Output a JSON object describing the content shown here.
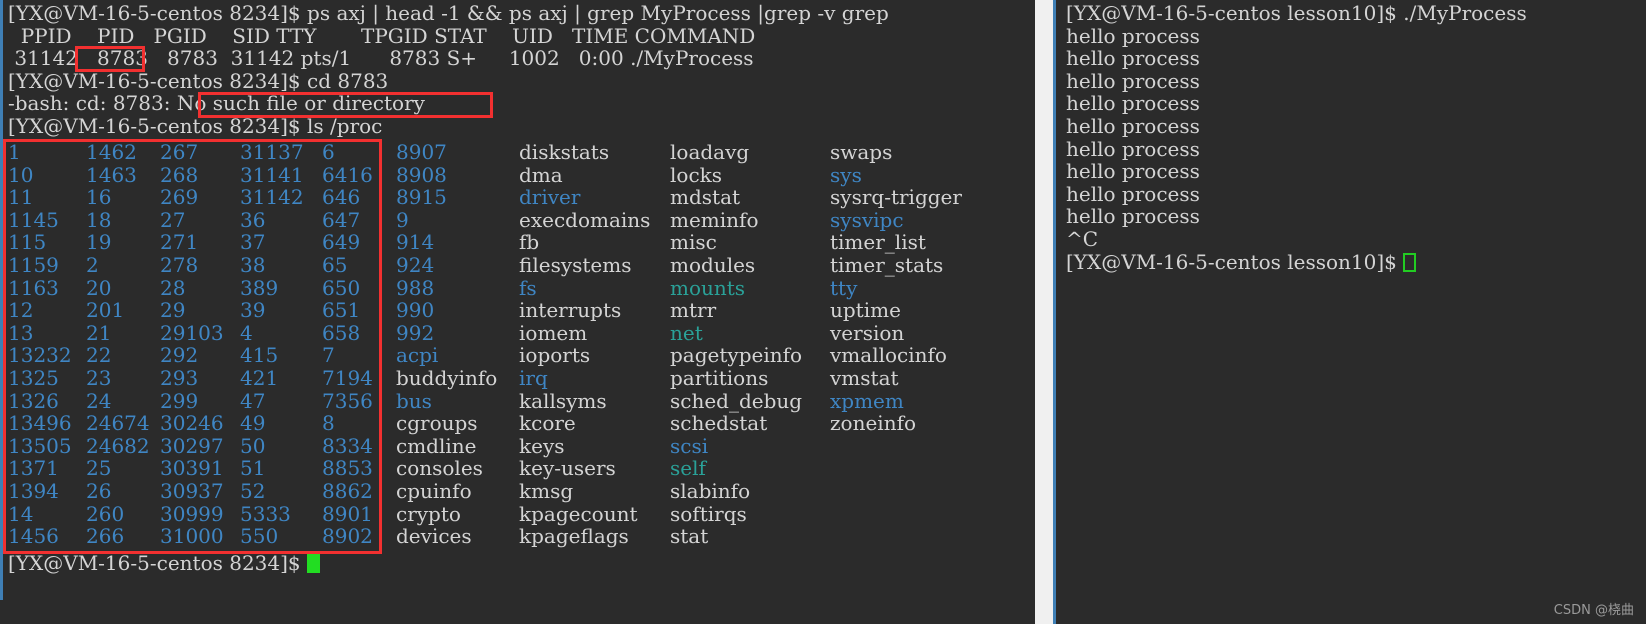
{
  "left_terminal": {
    "lines": [
      "[YX@VM-16-5-centos 8234]$ ps axj | head -1 && ps axj | grep MyProcess |grep -v grep",
      "  PPID    PID   PGID    SID TTY       TPGID STAT    UID   TIME COMMAND",
      " 31142   8783   8783  31142 pts/1      8783 S+     1002   0:00 ./MyProcess",
      "[YX@VM-16-5-centos 8234]$ cd 8783",
      "-bash: cd: 8783: No such file or directory",
      "[YX@VM-16-5-centos 8234]$ ls /proc"
    ],
    "prompt_final": "[YX@VM-16-5-centos 8234]$ ",
    "proc_listing": {
      "numeric_columns": [
        [
          "1",
          "10",
          "11",
          "1145",
          "115",
          "1159",
          "1163",
          "12",
          "13",
          "13232",
          "1325",
          "1326",
          "13496",
          "13505",
          "1371",
          "1394",
          "14",
          "1456"
        ],
        [
          "1462",
          "1463",
          "16",
          "18",
          "19",
          "2",
          "20",
          "201",
          "21",
          "22",
          "23",
          "24",
          "24674",
          "24682",
          "25",
          "26",
          "260",
          "266"
        ],
        [
          "267",
          "268",
          "269",
          "27",
          "271",
          "278",
          "28",
          "29",
          "29103",
          "292",
          "293",
          "299",
          "30246",
          "30297",
          "30391",
          "30937",
          "30999",
          "31000"
        ],
        [
          "31137",
          "31141",
          "31142",
          "36",
          "37",
          "38",
          "389",
          "39",
          "4",
          "415",
          "421",
          "47",
          "49",
          "50",
          "51",
          "52",
          "5333",
          "550"
        ],
        [
          "6",
          "6416",
          "646",
          "647",
          "649",
          "65",
          "650",
          "651",
          "658",
          "7",
          "7194",
          "7356",
          "8",
          "8334",
          "8853",
          "8862",
          "8901",
          "8902"
        ],
        [
          "8907",
          "8908",
          "8915",
          "9",
          "914",
          "924",
          "988",
          "990",
          "992",
          "acpi",
          "buddyinfo",
          "bus",
          "cgroups",
          "cmdline",
          "consoles",
          "cpuinfo",
          "crypto",
          "devices"
        ]
      ],
      "numeric_column_types": [
        [
          "dir",
          "dir",
          "dir",
          "dir",
          "dir",
          "dir",
          "dir",
          "dir",
          "dir",
          "dir",
          "dir",
          "dir",
          "dir",
          "dir",
          "dir",
          "dir",
          "dir",
          "dir"
        ],
        [
          "dir",
          "dir",
          "dir",
          "dir",
          "dir",
          "dir",
          "dir",
          "dir",
          "dir",
          "dir",
          "dir",
          "dir",
          "dir",
          "dir",
          "dir",
          "dir",
          "dir",
          "dir"
        ],
        [
          "dir",
          "dir",
          "dir",
          "dir",
          "dir",
          "dir",
          "dir",
          "dir",
          "dir",
          "dir",
          "dir",
          "dir",
          "dir",
          "dir",
          "dir",
          "dir",
          "dir",
          "dir"
        ],
        [
          "dir",
          "dir",
          "dir",
          "dir",
          "dir",
          "dir",
          "dir",
          "dir",
          "dir",
          "dir",
          "dir",
          "dir",
          "dir",
          "dir",
          "dir",
          "dir",
          "dir",
          "dir"
        ],
        [
          "dir",
          "dir",
          "dir",
          "dir",
          "dir",
          "dir",
          "dir",
          "dir",
          "dir",
          "dir",
          "dir",
          "dir",
          "dir",
          "dir",
          "dir",
          "dir",
          "dir",
          "dir"
        ],
        [
          "dir",
          "dir",
          "dir",
          "dir",
          "dir",
          "dir",
          "dir",
          "dir",
          "dir",
          "dir",
          "file",
          "dir",
          "file",
          "file",
          "file",
          "file",
          "file",
          "file"
        ]
      ],
      "name_column_7": [
        "diskstats",
        "dma",
        "driver",
        "execdomains",
        "fb",
        "filesystems",
        "fs",
        "interrupts",
        "iomem",
        "ioports",
        "irq",
        "kallsyms",
        "kcore",
        "keys",
        "key-users",
        "kmsg",
        "kpagecount",
        "kpageflags"
      ],
      "name_column_7_types": [
        "file",
        "file",
        "dir",
        "file",
        "file",
        "file",
        "dir",
        "file",
        "file",
        "file",
        "dir",
        "file",
        "file",
        "file",
        "file",
        "file",
        "file",
        "file"
      ],
      "name_column_8": [
        "loadavg",
        "locks",
        "mdstat",
        "meminfo",
        "misc",
        "modules",
        "mounts",
        "mtrr",
        "net",
        "pagetypeinfo",
        "partitions",
        "sched_debug",
        "schedstat",
        "scsi",
        "self",
        "slabinfo",
        "softirqs",
        "stat"
      ],
      "name_column_8_types": [
        "file",
        "file",
        "file",
        "file",
        "file",
        "file",
        "link",
        "file",
        "link",
        "file",
        "file",
        "file",
        "file",
        "dir",
        "link",
        "file",
        "file",
        "file"
      ],
      "name_column_9": [
        "swaps",
        "sys",
        "sysrq-trigger",
        "sysvipc",
        "timer_list",
        "timer_stats",
        "tty",
        "uptime",
        "version",
        "vmallocinfo",
        "vmstat",
        "xpmem",
        "zoneinfo"
      ],
      "name_column_9_types": [
        "file",
        "dir",
        "file",
        "dir",
        "file",
        "file",
        "dir",
        "file",
        "file",
        "file",
        "file",
        "dir",
        "file"
      ]
    },
    "annotations": {
      "pid_highlight": "8783",
      "error_highlight": "No such file or directory",
      "proc_listing_highlight": "numeric pid directory columns"
    }
  },
  "right_terminal": {
    "lines": [
      "[YX@VM-16-5-centos lesson10]$ ./MyProcess",
      "hello process",
      "hello process",
      "hello process",
      "hello process",
      "hello process",
      "hello process",
      "hello process",
      "hello process",
      "hello process",
      "^C",
      "[YX@VM-16-5-centos lesson10]$ "
    ]
  },
  "watermark": "CSDN @桡曲",
  "colors": {
    "background": "#2b2b2b",
    "foreground": "#d4d4d4",
    "directory_blue": "#3f86c4",
    "symlink_teal": "#2aa198",
    "cursor_green": "#22dd22",
    "annotation_red": "#f23030",
    "pane_border_blue": "#3f7fb5",
    "separator_gray": "#f0f0f0"
  }
}
